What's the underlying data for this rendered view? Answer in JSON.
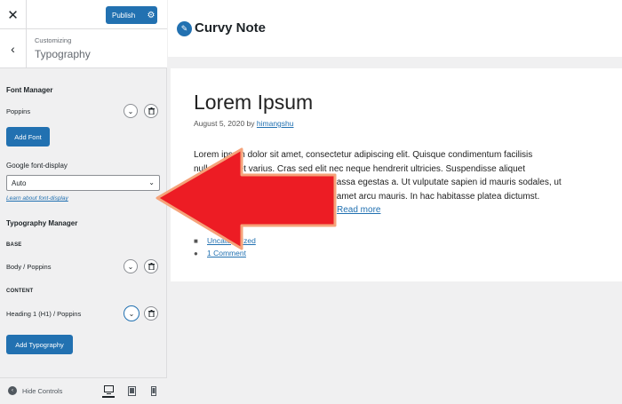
{
  "topbar": {
    "close_glyph": "✕",
    "publish_label": "Publish",
    "gear_glyph": "⚙"
  },
  "section": {
    "back_glyph": "‹",
    "customizing": "Customizing",
    "title": "Typography"
  },
  "font_manager": {
    "heading": "Font Manager",
    "font_name": "Poppins",
    "add_font_label": "Add Font"
  },
  "font_display": {
    "label": "Google font-display",
    "selected": "Auto",
    "learn_link": "Learn about font-display"
  },
  "typography_manager": {
    "heading": "Typography Manager",
    "base_label": "BASE",
    "base_item": "Body / Poppins",
    "content_label": "CONTENT",
    "content_item": "Heading 1 (H1) / Poppins",
    "add_label": "Add Typography"
  },
  "icons": {
    "chevron": "⌄",
    "trash": "🗑"
  },
  "footer": {
    "hide_controls": "Hide Controls"
  },
  "preview": {
    "site_title": "Curvy Note",
    "post_title": "Lorem Ipsum",
    "date": "August 5, 2020 by",
    "author": "himangshu",
    "body_line1": "Lorem ipsum dolor sit amet, consectetur adipiscing elit. Quisque condimentum facilisis",
    "body_line2": "nulla sit amet varius. Cras sed elit nec neque hendrerit ultricies. Suspendisse aliquet",
    "body_line3": "nunc massa egestas a. Ut vulputate sapien id mauris sodales, ut",
    "body_line4": "sit amet arcu mauris. In hac habitasse platea dictumst.",
    "read_more": "Read more",
    "category": "Uncategorized",
    "comments": "1 Comment"
  },
  "colors": {
    "accent": "#2271b1",
    "arrow_fill": "#ed1c24",
    "arrow_stroke": "#f5a37a"
  }
}
